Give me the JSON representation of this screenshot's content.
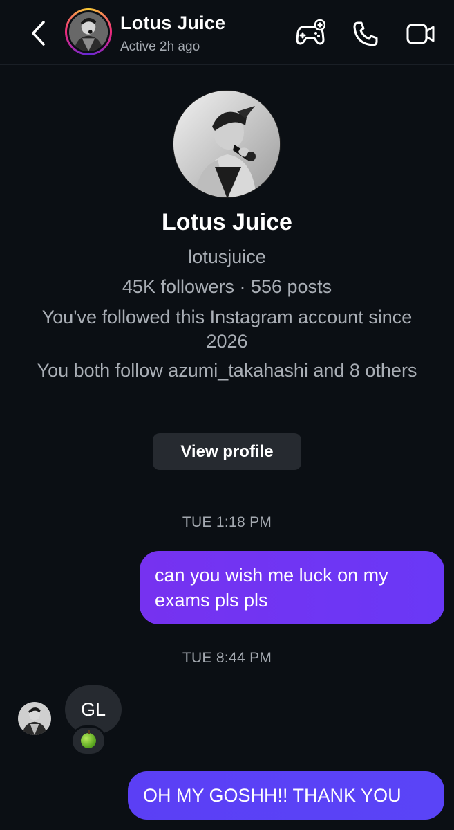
{
  "header": {
    "name": "Lotus Juice",
    "status": "Active 2h ago",
    "back_icon": "chevron-left-icon",
    "actions": [
      "game-controller-icon",
      "phone-icon",
      "video-camera-icon"
    ]
  },
  "profile": {
    "name": "Lotus Juice",
    "handle": "lotusjuice",
    "stats": "45K followers · 556 posts",
    "since": "You've followed this Instagram account since 2026",
    "mutual": "You both follow azumi_takahashi and 8 others",
    "view_profile_label": "View profile"
  },
  "messages": {
    "timestamp_1": "TUE 1:18 PM",
    "outgoing_1": "can you wish me luck on my exams pls pls",
    "timestamp_2": "TUE 8:44 PM",
    "incoming_1": "GL",
    "reaction_1": "green-apple-emoji",
    "outgoing_2": "OH MY GOSHH!! THANK YOU"
  },
  "colors": {
    "background": "#0b0f14",
    "outgoing_bubble": "#6b2cf0",
    "incoming_bubble": "#262a30",
    "secondary_text": "#a9aeb5"
  }
}
